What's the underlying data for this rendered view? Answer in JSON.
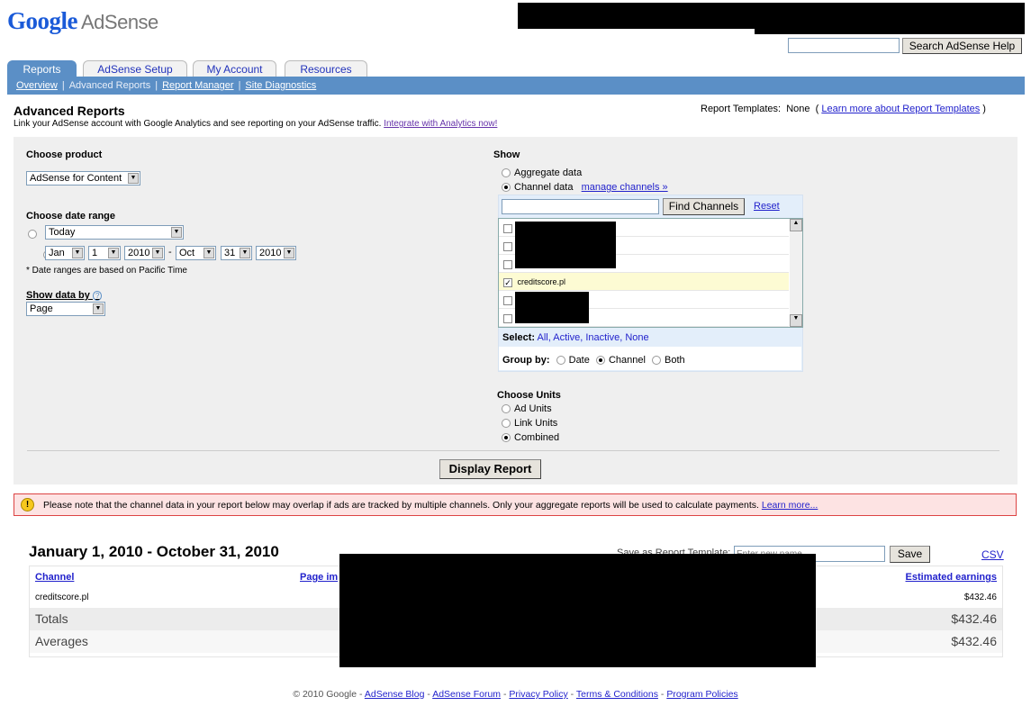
{
  "header": {
    "logo_google": "Google",
    "logo_product": "AdSense",
    "search_placeholder": "",
    "search_button": "Search AdSense Help"
  },
  "tabs": [
    {
      "label": "Reports",
      "active": true
    },
    {
      "label": "AdSense Setup"
    },
    {
      "label": "My Account"
    },
    {
      "label": "Resources"
    }
  ],
  "subnav": [
    {
      "label": "Overview"
    },
    {
      "label": "Advanced Reports",
      "active": true
    },
    {
      "label": "Report Manager"
    },
    {
      "label": "Site Diagnostics"
    }
  ],
  "page": {
    "title": "Advanced Reports",
    "description": "Link your AdSense account with Google Analytics and see reporting on your AdSense traffic.",
    "analytics_link": "Integrate with Analytics now!",
    "templates_label": "Report Templates:",
    "templates_value": "None",
    "templates_link": "Learn more about Report Templates"
  },
  "form": {
    "product_label": "Choose product",
    "product_value": "AdSense for Content",
    "date_label": "Choose date range",
    "preset_value": "Today",
    "from_month": "Jan",
    "from_day": "1",
    "from_year": "2010",
    "to_month": "Oct",
    "to_day": "31",
    "to_year": "2010",
    "date_note": "* Date ranges are based on Pacific Time",
    "showby_label": "Show data by",
    "showby_value": "Page",
    "show_label": "Show",
    "aggregate": "Aggregate data",
    "channel": "Channel data",
    "manage_link": "manage channels »",
    "find_button": "Find Channels",
    "reset_link": "Reset",
    "channels": [
      {
        "name": "",
        "checked": false
      },
      {
        "name": "",
        "checked": false
      },
      {
        "name": "",
        "checked": false
      },
      {
        "name": "creditscore.pl",
        "checked": true
      },
      {
        "name": "",
        "checked": false
      },
      {
        "name": "",
        "checked": false
      }
    ],
    "select_label": "Select:",
    "select_options": "All, Active, Inactive, None",
    "groupby_label": "Group by:",
    "group_date": "Date",
    "group_channel": "Channel",
    "group_both": "Both",
    "units_label": "Choose Units",
    "unit_ad": "Ad Units",
    "unit_link": "Link Units",
    "unit_combined": "Combined",
    "display_button": "Display Report"
  },
  "warning": {
    "text": "Please note that the channel data in your report below may overlap if ads are tracked by multiple channels. Only your aggregate reports will be used to calculate payments.",
    "link": "Learn more..."
  },
  "report": {
    "title": "January 1, 2010 - October 31, 2010",
    "save_label": "Save as Report Template:",
    "save_placeholder": "Enter new name",
    "save_button": "Save",
    "csv": "CSV",
    "columns": [
      "Channel",
      "Page im",
      "Estimated earnings"
    ],
    "rows": [
      {
        "channel": "creditscore.pl",
        "earnings": "$432.46"
      }
    ],
    "totals_label": "Totals",
    "totals": "$432.46",
    "averages_label": "Averages",
    "averages": "$432.46"
  },
  "footer": {
    "copyright": "© 2010 Google -",
    "links": [
      "AdSense Blog",
      "AdSense Forum",
      "Privacy Policy",
      "Terms & Conditions",
      "Program Policies"
    ]
  }
}
